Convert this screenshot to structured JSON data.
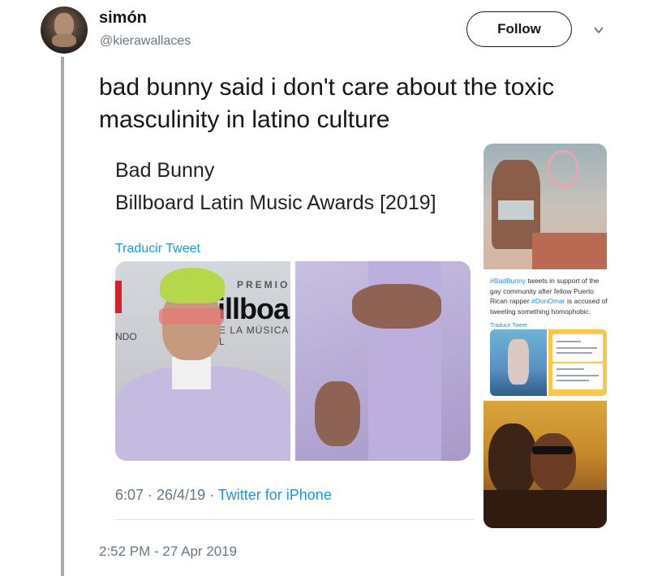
{
  "user": {
    "display_name": "simón",
    "handle": "@kierawallaces",
    "follow_label": "Follow"
  },
  "tweet": {
    "text": "bad bunny said i don't care about the toxic masculinity in latino culture",
    "timestamp": "2:52 PM - 27 Apr 2019"
  },
  "embedded_tweet": {
    "title_line1": "Bad Bunny",
    "title_line2": "Billboard Latin Music Awards [2019]",
    "translate_label": "Traducir Tweet",
    "time": "6:07 · 26/4/19 · ",
    "source": "Twitter for iPhone",
    "photo_left": {
      "premio": "PREMIO",
      "billboard": "illboa",
      "la_musica": "E LA MÚSICA L",
      "ndo": "NDO"
    }
  },
  "side_collage": {
    "hashtag1": "#BadBunny",
    "text1": " tweets in support of the gay community after fellow Puerto Rican rapper ",
    "hashtag2": "#DonOmar",
    "text2": " is accused of tweeting something homophobic.",
    "translate_label": "Traducir Tweet"
  },
  "colors": {
    "link": "#1b95e0",
    "meta": "#657786",
    "thread_line": "#a8a8a8"
  },
  "icons": {
    "menu": "chevron-down-icon"
  }
}
